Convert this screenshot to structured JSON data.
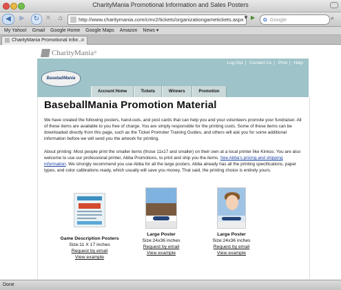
{
  "window": {
    "title": "CharityMania Promotional Information and Sales Posters"
  },
  "toolbar": {
    "url": "http://www.charitymania.com/cmv2/tickets/organizationgametickets.aspx",
    "search_placeholder": "Google"
  },
  "bookmarks": [
    "My Yahoo!",
    "Gmail",
    "Google Home",
    "Google Maps",
    "Amazon",
    "News ▾"
  ],
  "tab": {
    "label": "CharityMania Promotional Infor..."
  },
  "site": {
    "logo_text": "CharityMania",
    "logo_tm": "®",
    "top_links": [
      "Log Out",
      "Contact Us",
      "Print",
      "Help"
    ],
    "brand_logo_text": "BaseballMania",
    "nav": [
      "Account Home",
      "Tickets",
      "Winners",
      "Promotion"
    ]
  },
  "page": {
    "title": "BaseballMania  Promotion Material",
    "intro": "We have created the following posters, hand-outs, and post cards that can help you and your volunteers promote your fundraiser. All of these items are available to you free of charge. You are simply responsible for the printing costs. Some of these items can be downloaded directly from this page, such as the Ticket Promoter Training Guides, and others will ask you for some additional information before we will send you the artwork for printing.",
    "printing_before": "About printing: Most people print the smaller items (those 11x17 and smaller) on their own at a local printer like Kinkos. You are also welcome to use our professional printer, Abba Promotions, to print and ship you the items. ",
    "printing_link": "See Abba's pricing and shipping information",
    "printing_after": ". We strongly recommend you use Abba for all the large posters. Abba already has all the printing specifications, paper types, and color calibrations ready, which usually will save you money. That said, the printing choice is entirely yours."
  },
  "items": [
    {
      "name": "Game Description Posters",
      "size": "Size:11 X 17 inches",
      "request": "Request by email",
      "view": "View example"
    },
    {
      "name": "Large Poster",
      "size": "Size:24x36 inches",
      "request": "Request by email",
      "view": "View example"
    },
    {
      "name": "Large Poster",
      "size": "Size:24x36 inches",
      "request": "Request by email",
      "view": "View example"
    }
  ],
  "status": {
    "text": "Done"
  }
}
